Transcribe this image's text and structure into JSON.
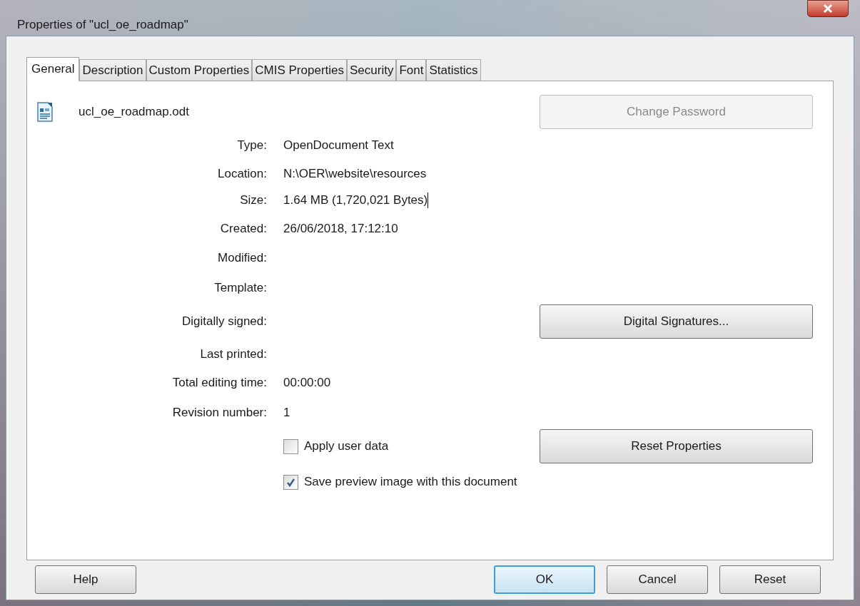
{
  "window": {
    "title": "Properties of \"ucl_oe_roadmap\""
  },
  "tabs": [
    {
      "label": "General",
      "selected": true
    },
    {
      "label": "Description",
      "selected": false
    },
    {
      "label": "Custom Properties",
      "selected": false
    },
    {
      "label": "CMIS Properties",
      "selected": false
    },
    {
      "label": "Security",
      "selected": false
    },
    {
      "label": "Font",
      "selected": false
    },
    {
      "label": "Statistics",
      "selected": false
    }
  ],
  "file": {
    "name": "ucl_oe_roadmap.odt"
  },
  "change_password": {
    "label": "Change Password",
    "disabled": true
  },
  "rows": [
    {
      "kind": "field",
      "label": "Type:",
      "value": "OpenDocument Text"
    },
    {
      "kind": "field",
      "label": "Location:",
      "value": "N:\\OER\\website\\resources"
    },
    {
      "kind": "field",
      "label": "Size:",
      "value": "1.64 MB (1,720,021 Bytes)",
      "focused": true
    },
    {
      "kind": "field",
      "label": "Created:",
      "value": "26/06/2018, 17:12:10"
    },
    {
      "kind": "field",
      "label": "Modified:"
    },
    {
      "kind": "field",
      "label": "Template:"
    },
    {
      "kind": "field",
      "label": "Digitally signed:",
      "button": "Digital Signatures..."
    },
    {
      "kind": "field",
      "label": "Last printed:"
    },
    {
      "kind": "field",
      "label": "Total editing time:",
      "value": "00:00:00"
    },
    {
      "kind": "field",
      "label": "Revision number:",
      "value": "1"
    },
    {
      "kind": "checkbox",
      "label": "Apply user data",
      "checked": false,
      "button": "Reset Properties"
    },
    {
      "kind": "checkbox",
      "label": "Save preview image with this document",
      "checked": true
    }
  ],
  "buttons": [
    {
      "label": "Help",
      "default": false
    },
    {
      "label": "OK",
      "default": true
    },
    {
      "label": "Cancel",
      "default": false
    },
    {
      "label": "Reset",
      "default": false
    }
  ]
}
